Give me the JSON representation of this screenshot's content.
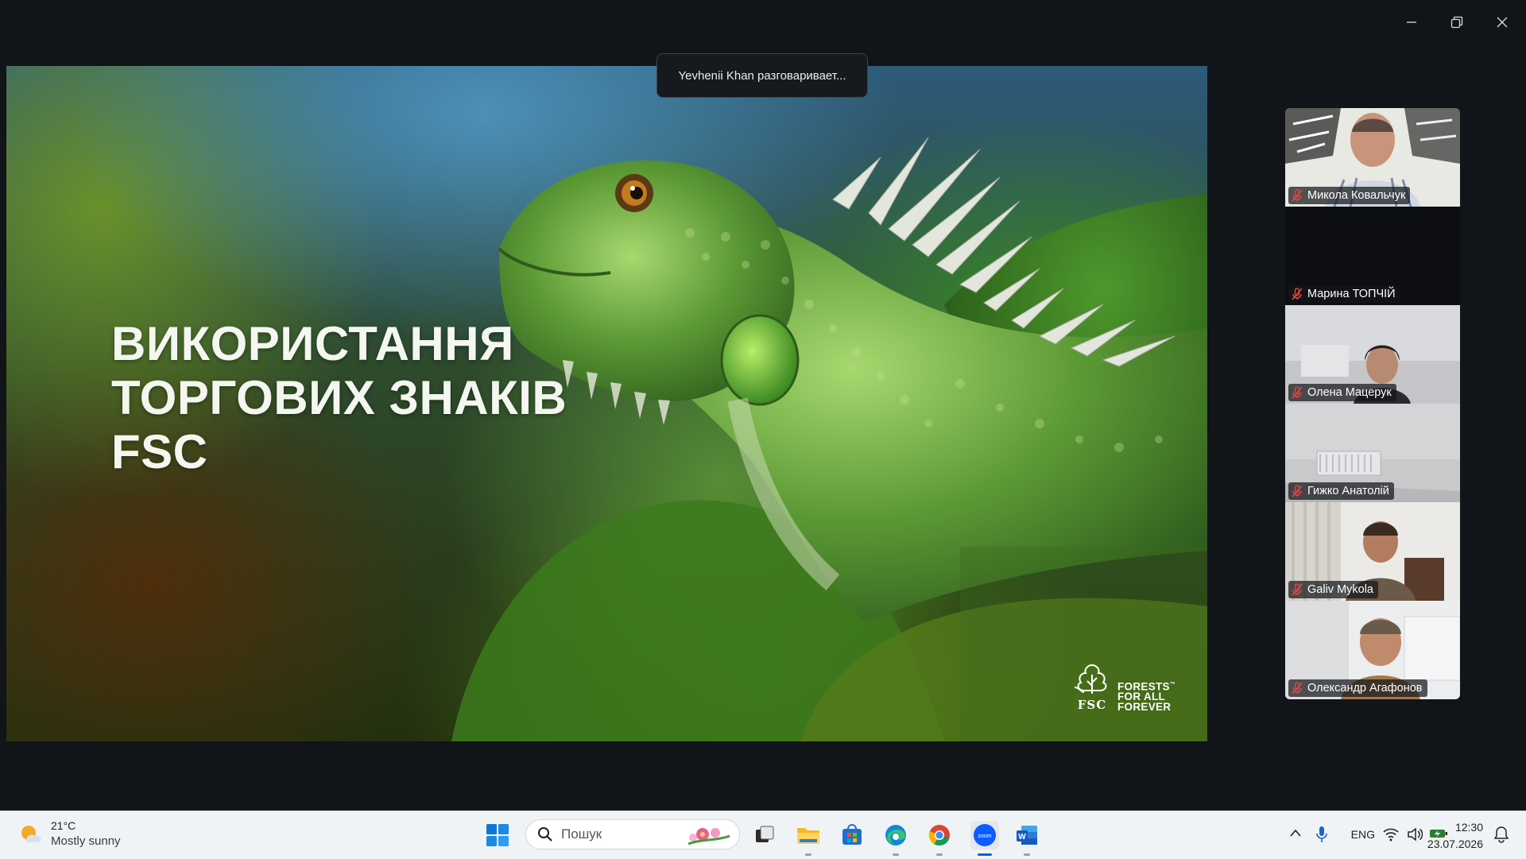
{
  "window": {
    "controls": [
      "minimize-icon",
      "restore-icon",
      "close-icon"
    ]
  },
  "tooltip": {
    "talking": "Yevhenii Khan разговаривает..."
  },
  "slide": {
    "title": "ВИКОРИСТАННЯ\nТОРГОВИХ ЗНАКІВ\nFSC",
    "logo": {
      "brand": "FSC",
      "slogan_line1": "FORESTS",
      "slogan_line2": "FOR ALL",
      "slogan_line3": "FOREVER",
      "trademark": "™"
    }
  },
  "participants": [
    {
      "name": "Микола Ковальчук",
      "muted": true
    },
    {
      "name": "Марина ТОПЧІЙ",
      "muted": true
    },
    {
      "name": "Олена Мацерук",
      "muted": true
    },
    {
      "name": "Гижко Анатолій",
      "muted": true
    },
    {
      "name": "Galiv Mykola",
      "muted": true
    },
    {
      "name": "Олександр Агафонов",
      "muted": true
    }
  ],
  "taskbar": {
    "weather": {
      "temp": "21°C",
      "condition": "Mostly sunny"
    },
    "search_placeholder": "Пошук",
    "apps": [
      "file-explorer",
      "microsoft-store",
      "edge",
      "chrome",
      "zoom",
      "word"
    ],
    "active_app": "zoom",
    "tray": {
      "language": "ENG"
    },
    "clock": {
      "time": "12:30",
      "date": "23.07.2026"
    }
  },
  "colors": {
    "background": "#111418",
    "taskbar": "#f0f3f6",
    "accent": "#0a5ed7",
    "mute_red": "#e0463c"
  }
}
